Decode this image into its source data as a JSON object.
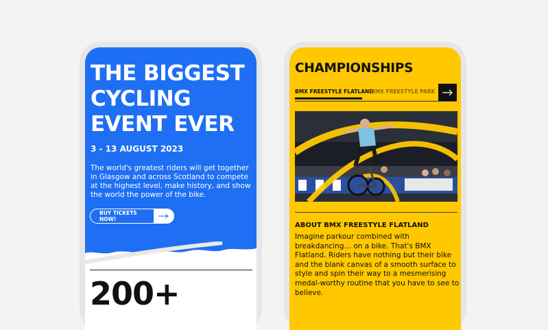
{
  "left_screen": {
    "hero_title": "THE BIGGEST CYCLING EVENT EVER",
    "dates": "3 - 13 AUGUST 2023",
    "description": "The world's greatest riders will get together in Glasgow and across Scotland to compete at the highest level, make history, and show the world the power of the bike.",
    "cta_label": "BUY TICKETS NOW!",
    "cta_icon": "arrow-right-icon",
    "stat_number": "200+",
    "colors": {
      "primary": "#1e6ff3",
      "text": "#ffffff"
    }
  },
  "right_screen": {
    "section_title": "CHAMPIONSHIPS",
    "tabs": [
      {
        "label": "BMX FREESTYLE FLATLAND",
        "active": true
      },
      {
        "label": "BMX FREESTYLE PARK",
        "active": false
      }
    ],
    "tab_next_icon": "arrow-right-icon",
    "photo": "bmx-rider-photo",
    "about_title": "ABOUT BMX FREESTYLE FLATLAND",
    "about_description": "Imagine parkour combined with breakdancing… on a bike. That's BMX Flatland. Riders have nothing but their bike and the blank canvas of a smooth surface to style and spin their way to a mesmerising medal-worthy routine that you have to see to believe.",
    "colors": {
      "primary": "#ffc800",
      "text": "#111111"
    }
  }
}
